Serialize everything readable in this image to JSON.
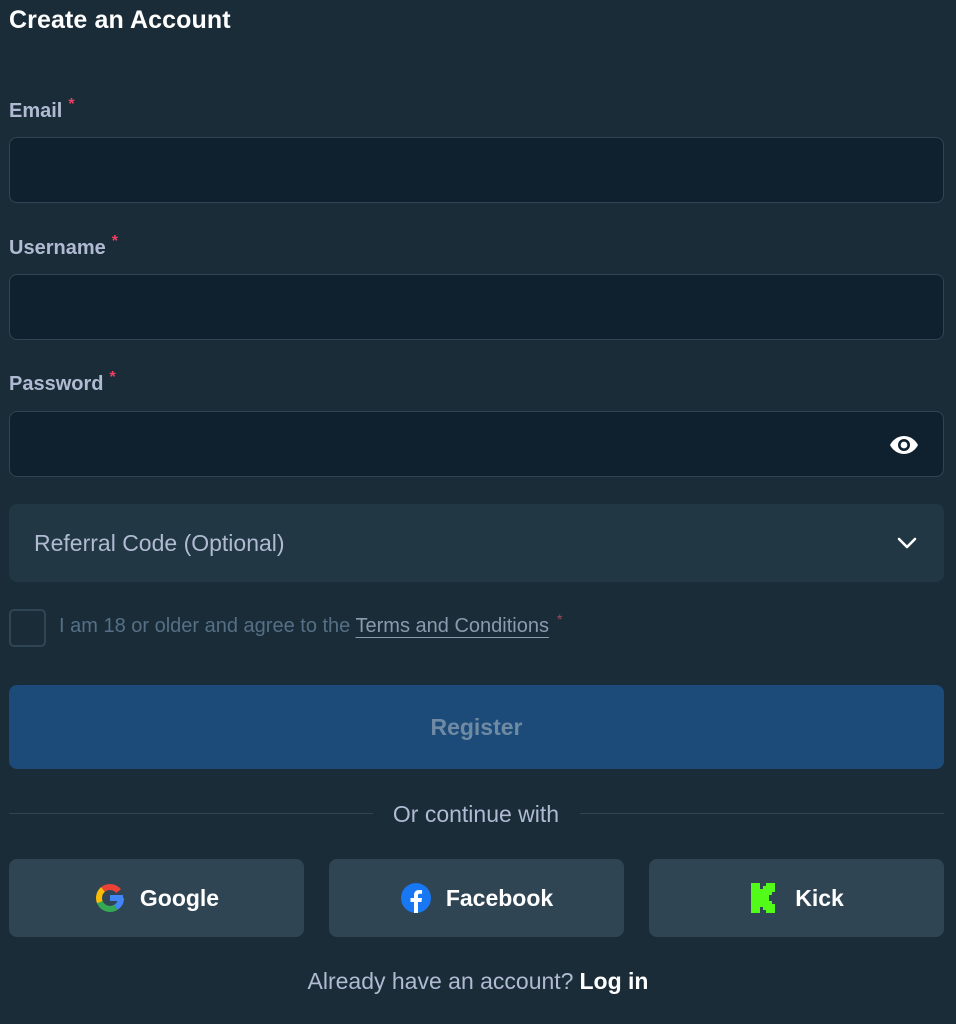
{
  "title": "Create an Account",
  "email": {
    "label": "Email",
    "required_mark": "*",
    "value": "",
    "placeholder": ""
  },
  "username": {
    "label": "Username",
    "required_mark": "*",
    "value": "",
    "placeholder": ""
  },
  "password": {
    "label": "Password",
    "required_mark": "*",
    "value": "",
    "placeholder": "",
    "toggle_icon": "eye-icon"
  },
  "referral": {
    "label": "Referral Code (Optional)",
    "icon": "chevron-down-icon"
  },
  "agreement": {
    "text": "I am 18 or older and agree to the",
    "link": "Terms and Conditions",
    "required_mark": "*",
    "checked": false
  },
  "register_label": "Register",
  "divider_text": "Or continue with",
  "social": [
    {
      "label": "Google",
      "icon": "google-icon"
    },
    {
      "label": "Facebook",
      "icon": "facebook-icon"
    },
    {
      "label": "Kick",
      "icon": "kick-icon"
    }
  ],
  "footer": {
    "prompt": "Already have an account?",
    "link": "Log in"
  },
  "colors": {
    "background": "#1a2c38",
    "input_bg": "#0f212e",
    "button_primary": "#1c4a79",
    "social_bg": "#2f4553",
    "required": "#ed4163",
    "kick_green": "#53fc18",
    "facebook_blue": "#1877f2"
  }
}
